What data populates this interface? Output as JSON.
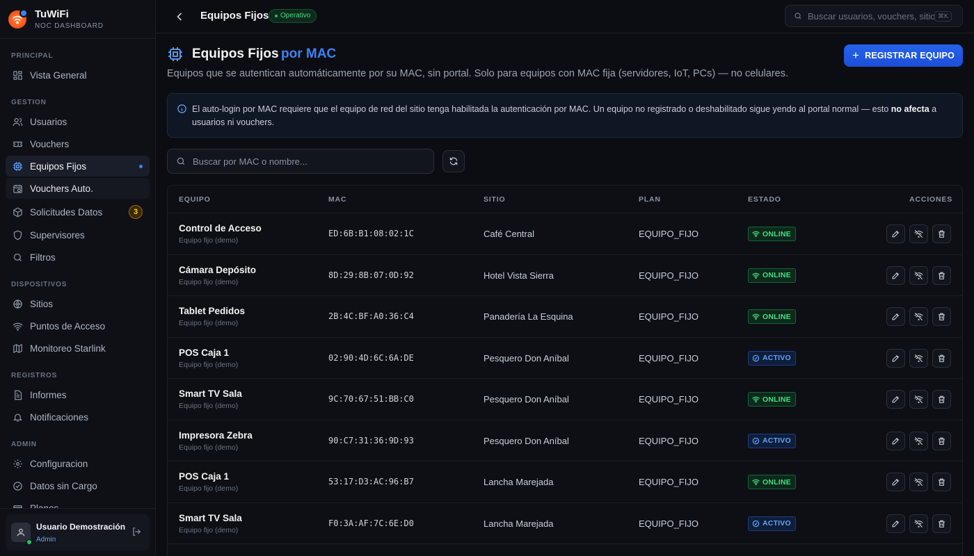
{
  "brand": {
    "name": "TuWiFi",
    "subtitle": "NOC DASHBOARD"
  },
  "sidebar": {
    "sections": {
      "principal": "PRINCIPAL",
      "gestion": "GESTION",
      "dispositivos": "DISPOSITIVOS",
      "registros": "REGISTROS",
      "admin": "ADMIN"
    },
    "items": {
      "vista_general": "Vista General",
      "usuarios": "Usuarios",
      "vouchers": "Vouchers",
      "equipos_fijos": "Equipos Fijos",
      "vouchers_auto": "Vouchers Auto.",
      "solicitudes_datos": "Solicitudes Datos",
      "solicitudes_count": "3",
      "supervisores": "Supervisores",
      "filtros": "Filtros",
      "sitios": "Sitios",
      "puntos_acceso": "Puntos de Acceso",
      "monitoreo_starlink": "Monitoreo Starlink",
      "informes": "Informes",
      "notificaciones": "Notificaciones",
      "configuracion": "Configuracion",
      "datos_sin_cargo": "Datos sin Cargo",
      "planes": "Planes"
    },
    "user": {
      "name": "Usuario Demostración",
      "role": "Admin"
    }
  },
  "topbar": {
    "title": "Equipos Fijos",
    "status": "Operativo",
    "search_placeholder": "Buscar usuarios, vouchers, sitios...",
    "shortcut": "⌘K"
  },
  "header": {
    "title": "Equipos Fijos",
    "title_accent": "por MAC",
    "description": "Equipos que se autentican automáticamente por su MAC, sin portal. Solo para equipos con MAC fija (servidores, IoT, PCs) — no celulares.",
    "register_button": "REGISTRAR EQUIPO"
  },
  "info": {
    "text_before": "El auto-login por MAC requiere que el equipo de red del sitio tenga habilitada la autenticación por MAC. Un equipo no registrado o deshabilitado sigue yendo al portal normal — esto ",
    "text_bold": "no afecta",
    "text_after": " a usuarios ni vouchers."
  },
  "table_search": {
    "placeholder": "Buscar por MAC o nombre..."
  },
  "table": {
    "headers": {
      "equipo": "EQUIPO",
      "mac": "MAC",
      "sitio": "SITIO",
      "plan": "PLAN",
      "estado": "ESTADO",
      "acciones": "ACCIONES"
    },
    "rows": [
      {
        "name": "Control de Acceso",
        "sub": "Equipo fijo (demo)",
        "mac": "ED:6B:B1:08:02:1C",
        "site": "Café Central",
        "plan": "EQUIPO_FIJO",
        "status": "ONLINE"
      },
      {
        "name": "Cámara Depósito",
        "sub": "Equipo fijo (demo)",
        "mac": "8D:29:8B:07:0D:92",
        "site": "Hotel Vista Sierra",
        "plan": "EQUIPO_FIJO",
        "status": "ONLINE"
      },
      {
        "name": "Tablet Pedidos",
        "sub": "Equipo fijo (demo)",
        "mac": "2B:4C:BF:A0:36:C4",
        "site": "Panadería La Esquina",
        "plan": "EQUIPO_FIJO",
        "status": "ONLINE"
      },
      {
        "name": "POS Caja 1",
        "sub": "Equipo fijo (demo)",
        "mac": "02:90:4D:6C:6A:DE",
        "site": "Pesquero Don Aníbal",
        "plan": "EQUIPO_FIJO",
        "status": "ACTIVO"
      },
      {
        "name": "Smart TV Sala",
        "sub": "Equipo fijo (demo)",
        "mac": "9C:70:67:51:BB:C0",
        "site": "Pesquero Don Aníbal",
        "plan": "EQUIPO_FIJO",
        "status": "ONLINE"
      },
      {
        "name": "Impresora Zebra",
        "sub": "Equipo fijo (demo)",
        "mac": "90:C7:31:36:9D:93",
        "site": "Pesquero Don Aníbal",
        "plan": "EQUIPO_FIJO",
        "status": "ACTIVO"
      },
      {
        "name": "POS Caja 1",
        "sub": "Equipo fijo (demo)",
        "mac": "53:17:D3:AC:96:B7",
        "site": "Lancha Marejada",
        "plan": "EQUIPO_FIJO",
        "status": "ONLINE"
      },
      {
        "name": "Smart TV Sala",
        "sub": "Equipo fijo (demo)",
        "mac": "F0:3A:AF:7C:6E:D0",
        "site": "Lancha Marejada",
        "plan": "EQUIPO_FIJO",
        "status": "ACTIVO"
      }
    ]
  },
  "colors": {
    "accent": "#3b82f6",
    "online": "#4ade80",
    "activo": "#60a5fa",
    "background": "#0b0d12"
  }
}
